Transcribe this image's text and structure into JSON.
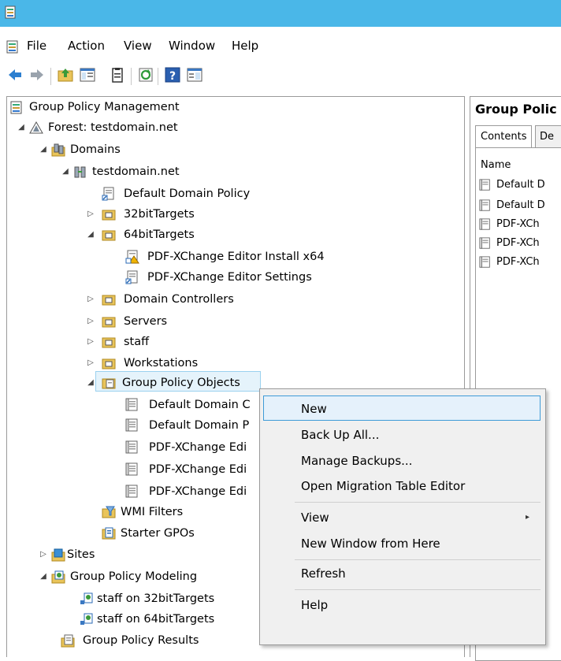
{
  "menubar": {
    "items": [
      "File",
      "Action",
      "View",
      "Window",
      "Help"
    ]
  },
  "toolbar": {
    "icons": [
      "back-icon",
      "forward-icon",
      "up-folder-icon",
      "show-hide-tree-icon",
      "properties-icon",
      "refresh-icon",
      "help-icon",
      "console-tree-icon"
    ]
  },
  "tree": {
    "root": "Group Policy Management",
    "forest": "Forest: testdomain.net",
    "domains": "Domains",
    "domain": "testdomain.net",
    "default_domain_policy": "Default Domain Policy",
    "ou_32": "32bitTargets",
    "ou_64": "64bitTargets",
    "pdf_install": "PDF-XChange Editor Install x64",
    "pdf_settings": "PDF-XChange Editor Settings",
    "domain_controllers": "Domain Controllers",
    "servers": "Servers",
    "staff": "staff",
    "workstations": "Workstations",
    "gpo": "Group Policy Objects",
    "gpo_items": [
      "Default Domain C",
      "Default Domain P",
      "PDF-XChange Edi",
      "PDF-XChange Edi",
      "PDF-XChange Edi"
    ],
    "wmi": "WMI Filters",
    "starter": "Starter GPOs",
    "sites": "Sites",
    "modeling": "Group Policy Modeling",
    "modeling_items": [
      "staff on 32bitTargets",
      "staff on 64bitTargets"
    ],
    "results": "Group Policy Results"
  },
  "right": {
    "title": "Group Polic",
    "tabs": [
      "Contents",
      "De"
    ],
    "column": "Name",
    "items": [
      "Default D",
      "Default D",
      "PDF-XCh",
      "PDF-XCh",
      "PDF-XCh"
    ]
  },
  "context_menu": {
    "items": [
      "New",
      "Back Up All...",
      "Manage Backups...",
      "Open Migration Table Editor",
      "View",
      "New Window from Here",
      "Refresh",
      "Help"
    ],
    "submenu_arrow": "▸"
  },
  "colors": {
    "titlebar": "#4ab7e8",
    "highlight_border": "#3e9bd7",
    "highlight_fill": "#e5f1fb"
  }
}
